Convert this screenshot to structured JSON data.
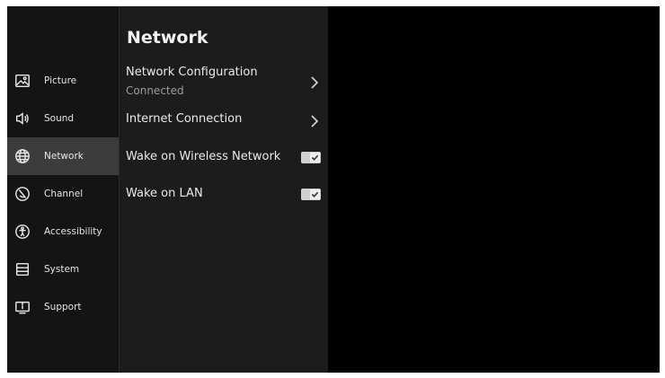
{
  "sidebar": {
    "items": [
      {
        "label": "Picture",
        "icon": "picture-icon",
        "active": false
      },
      {
        "label": "Sound",
        "icon": "sound-icon",
        "active": false
      },
      {
        "label": "Network",
        "icon": "globe-icon",
        "active": true
      },
      {
        "label": "Channel",
        "icon": "channel-icon",
        "active": false
      },
      {
        "label": "Accessibility",
        "icon": "accessibility-icon",
        "active": false
      },
      {
        "label": "System",
        "icon": "system-icon",
        "active": false
      },
      {
        "label": "Support",
        "icon": "support-icon",
        "active": false
      }
    ]
  },
  "panel": {
    "title": "Network",
    "rows": [
      {
        "label": "Network Configuration",
        "sublabel": "Connected",
        "type": "chevron"
      },
      {
        "label": "Internet Connection",
        "type": "chevron"
      },
      {
        "label": "Wake on Wireless Network",
        "type": "checkbox",
        "checked": true
      },
      {
        "label": "Wake on LAN",
        "type": "checkbox",
        "checked": true
      }
    ]
  },
  "colors": {
    "background": "#000000",
    "sidebar": "#141414",
    "panel": "#1c1c1c",
    "active_item": "#3c3c3c"
  }
}
